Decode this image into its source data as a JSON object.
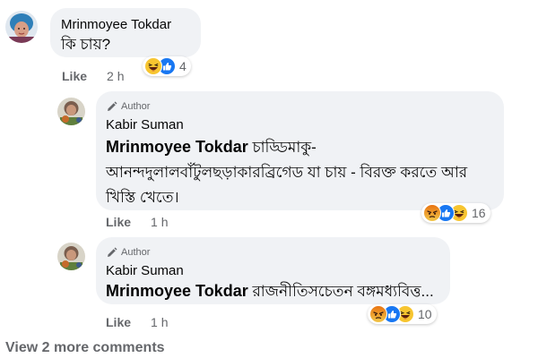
{
  "comments": [
    {
      "name": "Mrinmoyee Tokdar",
      "text": "কি চায়?",
      "like_label": "Like",
      "time": "2 h",
      "reaction_count": "4",
      "reactions": [
        "haha-icon",
        "like-icon"
      ]
    }
  ],
  "replies": [
    {
      "badge": "Author",
      "name": "Kabir Suman",
      "mention": "Mrinmoyee Tokdar",
      "text_line1": "চাড্ডিমাকু-",
      "text_line2": "আনন্দদুলালবাঁটুলছড়াকারব্রিগেড যা চায় - বিরক্ত করতে আর",
      "text_line3": "খিস্তি খেতে।",
      "like_label": "Like",
      "time": "1 h",
      "reaction_count": "16",
      "reactions": [
        "angry-icon",
        "like-icon",
        "haha-icon"
      ]
    },
    {
      "badge": "Author",
      "name": "Kabir Suman",
      "mention": "Mrinmoyee Tokdar",
      "text_line1": "রাজনীতিসচেতন বঙ্গমধ্যবিত্ত...",
      "like_label": "Like",
      "time": "1 h",
      "reaction_count": "10",
      "reactions": [
        "angry-icon",
        "like-icon",
        "haha-icon"
      ]
    }
  ],
  "view_more": "View 2 more comments",
  "colors": {
    "bubble": "#f0f2f5",
    "meta": "#65676b",
    "text": "#050505",
    "like_blue": "#1877f2",
    "haha_yellow": "#f7c530",
    "angry_orange": "#e9710f"
  }
}
